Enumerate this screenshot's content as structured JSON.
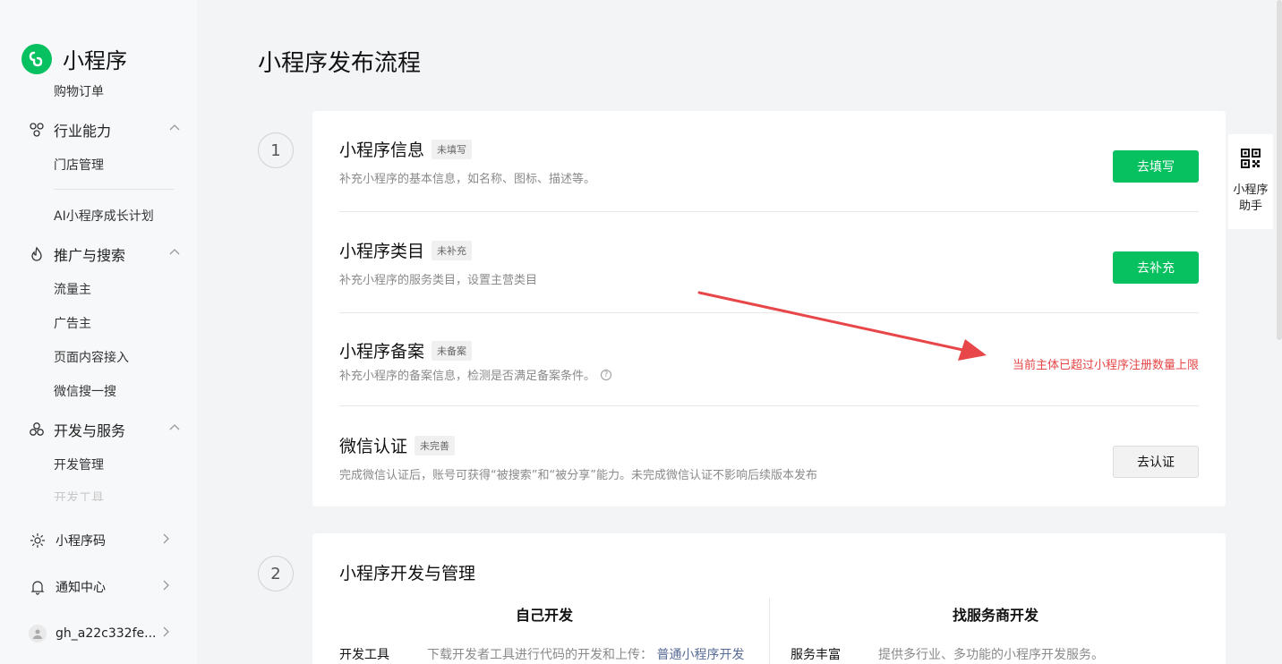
{
  "app": {
    "name": "小程序"
  },
  "sidebar": {
    "clipped_top_item": "购物订单",
    "groups": [
      {
        "label": "行业能力",
        "icon": "industry-icon",
        "items": [
          "门店管理"
        ]
      },
      {
        "label": "推广与搜索",
        "icon": "flame-icon",
        "items": [
          "流量主",
          "广告主",
          "页面内容接入",
          "微信搜一搜"
        ]
      },
      {
        "label": "开发与服务",
        "icon": "circles-icon",
        "items": [
          "开发管理",
          "开发工具"
        ]
      }
    ],
    "extra_item": "AI小程序成长计划",
    "bottom": [
      {
        "label": "小程序码",
        "icon": "sun-code-icon"
      },
      {
        "label": "通知中心",
        "icon": "bell-icon"
      },
      {
        "label": "gh_a22c332fe...",
        "icon": "user-avatar-icon"
      }
    ]
  },
  "main": {
    "title": "小程序发布流程",
    "steps": [
      {
        "number": "1",
        "rows": [
          {
            "title": "小程序信息",
            "badge": "未填写",
            "desc": "补充小程序的基本信息，如名称、图标、描述等。",
            "action": "去填写",
            "action_style": "primary"
          },
          {
            "title": "小程序类目",
            "badge": "未补充",
            "desc": "补充小程序的服务类目，设置主营类目",
            "action": "去补充",
            "action_style": "primary"
          },
          {
            "title": "小程序备案",
            "badge": "未备案",
            "desc": "补充小程序的备案信息，检测是否满足备案条件。",
            "warning": "当前主体已超过小程序注册数量上限"
          },
          {
            "title": "微信认证",
            "badge": "未完善",
            "desc": "完成微信认证后，账号可获得“被搜索”和“被分享”能力。未完成微信认证不影响后续版本发布",
            "action": "去认证",
            "action_style": "default"
          }
        ]
      },
      {
        "number": "2",
        "title": "小程序开发与管理",
        "columns": [
          {
            "title": "自己开发",
            "label": "开发工具",
            "desc": "下载开发者工具进行代码的开发和上传：",
            "link": "普通小程序开发"
          },
          {
            "title": "找服务商开发",
            "label": "服务丰富",
            "desc": "提供多行业、多功能的小程序开发服务。"
          }
        ]
      }
    ]
  },
  "helper": {
    "label": "小程序助手"
  },
  "colors": {
    "brand": "#07c160",
    "warning": "#e54545",
    "link": "#576b95",
    "annotation_arrow": "#e8474a"
  }
}
